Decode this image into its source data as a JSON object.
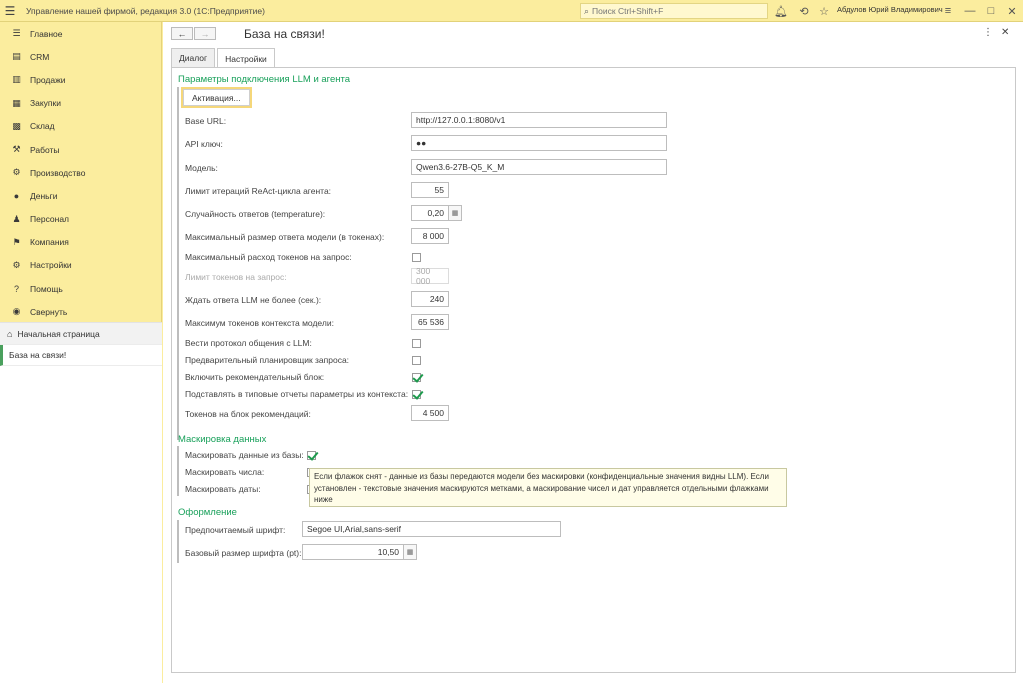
{
  "titlebar": {
    "app_title": "Управление нашей фирмой, редакция 3.0  (1С:Предприятие)",
    "search_placeholder": "Поиск Ctrl+Shift+F",
    "user": "Абдулов Юрий Владимирович"
  },
  "sidebar": {
    "items": [
      {
        "label": "Главное",
        "icon": "list-icon"
      },
      {
        "label": "CRM",
        "icon": "crm-icon"
      },
      {
        "label": "Продажи",
        "icon": "sales-icon"
      },
      {
        "label": "Закупки",
        "icon": "purchases-icon"
      },
      {
        "label": "Склад",
        "icon": "warehouse-icon"
      },
      {
        "label": "Работы",
        "icon": "works-icon"
      },
      {
        "label": "Производство",
        "icon": "production-icon"
      },
      {
        "label": "Деньги",
        "icon": "money-icon"
      },
      {
        "label": "Персонал",
        "icon": "staff-icon"
      },
      {
        "label": "Компания",
        "icon": "company-icon"
      },
      {
        "label": "Настройки",
        "icon": "settings-icon"
      },
      {
        "label": "Помощь",
        "icon": "help-icon"
      },
      {
        "label": "Свернуть",
        "icon": "collapse-icon"
      }
    ],
    "home": "Начальная страница",
    "open_window": "База на связи!"
  },
  "page": {
    "title": "База на связи!",
    "tabs": [
      {
        "label": "Диалог"
      },
      {
        "label": "Настройки"
      }
    ]
  },
  "llm": {
    "section_title": "Параметры подключения LLM и агента",
    "activate_button": "Активация...",
    "base_url_label": "Base URL:",
    "base_url": "http://127.0.0.1:8080/v1",
    "api_key_label": "API ключ:",
    "api_key": "●●",
    "model_label": "Модель:",
    "model": "Qwen3.6-27B-Q5_K_M",
    "iter_limit_label": "Лимит итераций ReAct-цикла агента:",
    "iter_limit": "55",
    "temperature_label": "Случайность ответов (temperature):",
    "temperature": "0,20",
    "max_answer_label": "Максимальный размер ответа модели (в токенах):",
    "max_answer": "8 000",
    "max_tokens_per_req_label": "Максимальный расход токенов на запрос:",
    "max_tokens_per_req": false,
    "token_limit_label": "Лимит токенов на запрос:",
    "token_limit": "300 000",
    "wait_label": "Ждать ответа LLM не более (сек.):",
    "wait": "240",
    "ctx_label": "Максимум токенов контекста модели:",
    "ctx": "65 536",
    "log_label": "Вести протокол общения с LLM:",
    "log": false,
    "planner_label": "Предварительный планировщик запроса:",
    "planner": false,
    "recommend_label": "Включить рекомендательный блок:",
    "recommend": true,
    "reports_label": "Подставлять в типовые отчеты параметры из контекста:",
    "reports": true,
    "rec_tokens_label": "Токенов на блок рекомендаций:",
    "rec_tokens": "4 500"
  },
  "masking": {
    "section_title": "Маскировка данных",
    "mask_data_label": "Маскировать данные из базы:",
    "mask_data": true,
    "mask_numbers_label": "Маскировать числа:",
    "mask_dates_label": "Маскировать даты:",
    "tooltip": "Если флажок снят - данные из базы передаются модели без маскировки (конфиденциальные значения видны LLM). Если установлен - текстовые значения маскируются метками, а маскирование чисел и дат управляется отдельными флажками ниже"
  },
  "design": {
    "section_title": "Оформление",
    "font_label": "Предпочитаемый шрифт:",
    "font": "Segoe UI,Arial,sans-serif",
    "font_size_label": "Базовый размер шрифта (pt):",
    "font_size": "10,50"
  }
}
